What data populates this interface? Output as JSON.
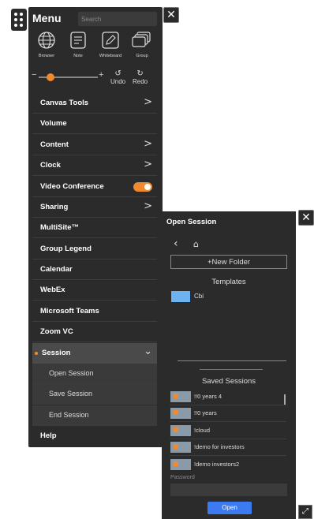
{
  "menu": {
    "title": "Menu",
    "search_placeholder": "Search",
    "tools": [
      {
        "label": "Browser",
        "icon": "globe-icon"
      },
      {
        "label": "Note",
        "icon": "note-icon"
      },
      {
        "label": "Whiteboard",
        "icon": "whiteboard-pen-icon"
      },
      {
        "label": "Group",
        "icon": "group-windows-icon"
      }
    ],
    "zoom": {
      "minus": "−",
      "plus": "+",
      "value_fraction": 0.2
    },
    "undo_label": "Undo",
    "redo_label": "Redo",
    "items": [
      {
        "label": "Canvas Tools",
        "chevron": ">"
      },
      {
        "label": "Volume"
      },
      {
        "label": "Content",
        "chevron": ">"
      },
      {
        "label": "Clock",
        "chevron": ">"
      },
      {
        "label": "Video Conference",
        "toggle_on": true
      },
      {
        "label": "Sharing",
        "chevron": ">"
      },
      {
        "label": "MultiSite™"
      },
      {
        "label": "Group Legend"
      },
      {
        "label": "Calendar"
      },
      {
        "label": "WebEx"
      },
      {
        "label": "Microsoft Teams"
      },
      {
        "label": "Zoom VC"
      }
    ],
    "session": {
      "label": "Session",
      "sub_items": [
        "Open Session",
        "Save Session",
        "End Session"
      ]
    },
    "help_label": "Help"
  },
  "open_session": {
    "title": "Open Session",
    "new_folder_label": "+New Folder",
    "templates_heading": "Templates",
    "templates": [
      {
        "name": "Cbi",
        "color": "#6cb3ef"
      }
    ],
    "saved_heading": "Saved Sessions",
    "saved_sessions": [
      {
        "name": "!!0 years 4"
      },
      {
        "name": "!!0 years"
      },
      {
        "name": "!cloud"
      },
      {
        "name": "!demo for investors"
      },
      {
        "name": "!demo investors2"
      }
    ],
    "password_label": "Password",
    "open_label": "Open"
  },
  "colors": {
    "panel": "#2b2b2b",
    "accent": "#ef8b2d",
    "primary_button": "#3b7bef"
  }
}
